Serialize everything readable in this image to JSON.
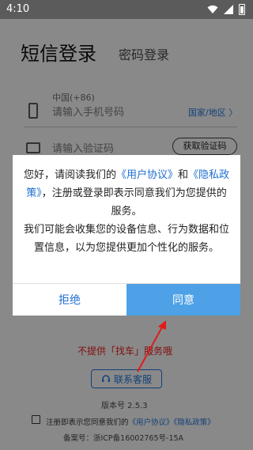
{
  "status": {
    "time": "4:10"
  },
  "login": {
    "title": "短信登录",
    "alt_title": "密码登录",
    "region_hint": "中国(+86)",
    "phone_placeholder": "请输入手机号码",
    "region_select": "国家/地区 〉",
    "code_placeholder": "请输入验证码",
    "get_code": "获取验证码"
  },
  "tip": "不提供「找车」服务哦",
  "contact": "联系客服",
  "version": "版本号 2.5.3",
  "agree": {
    "prefix": "注册即表示您同意我们的",
    "user_agreement": "《用户协议》",
    "privacy_policy": "《隐私政策》"
  },
  "record": "备案号：浙ICP备16002765号-15A",
  "modal": {
    "line1": "您好，请阅读我们的",
    "user_agreement": "《用户协议》",
    "and": "和",
    "privacy_policy": "《隐私政策》",
    "line2": "，注册或登录即表示同意我们为您提供的服务。",
    "line3": "我们可能会收集您的设备信息、行为数据和位置信息，以为您提供更加个性化的服务。",
    "reject": "拒绝",
    "accept": "同意"
  },
  "colors": {
    "accent": "#1e6fd0",
    "accept_bg": "#4ea1e6",
    "tip": "#e11a1a"
  },
  "icons": [
    "wifi-icon",
    "signal-icon",
    "battery-icon",
    "phone-icon",
    "code-icon",
    "headset-icon"
  ]
}
